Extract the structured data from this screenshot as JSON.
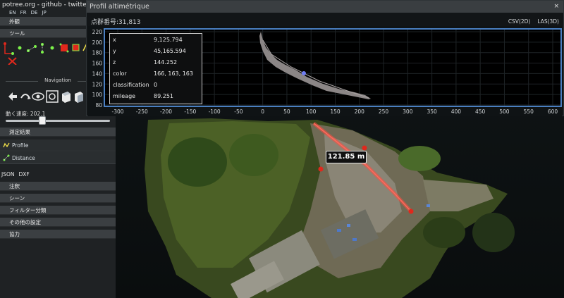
{
  "sidebar": {
    "brand": "potree.org - github - twitter",
    "languages": [
      "EN",
      "FR",
      "DE",
      "JP"
    ],
    "sections": {
      "appearance": "外観",
      "tools": "ツール",
      "navigation_title": "Navigation",
      "speed_label": "動く速度: 202.1",
      "measurements": "測定結果",
      "annotations": "注釈",
      "scene": "シーン",
      "filters": "フィルター分類",
      "other_settings": "その他の設定",
      "about": "協力"
    },
    "speed_slider": {
      "value": 0.35
    },
    "measurement_items": [
      {
        "label": "Profile",
        "icon": "profile-icon"
      },
      {
        "label": "Distance",
        "icon": "distance-icon"
      }
    ],
    "export": [
      "JSON",
      "DXF"
    ]
  },
  "profile_window": {
    "title": "Profil altimétrique",
    "close": "×",
    "point_count": "点群番号:31,813",
    "buttons": [
      "CSV(2D)",
      "LAS(3D)"
    ],
    "y_ticks": [
      "220",
      "200",
      "180",
      "160",
      "140",
      "120",
      "100",
      "80"
    ],
    "x_ticks": [
      "-300",
      "-250",
      "-200",
      "-150",
      "-100",
      "-50",
      "0",
      "50",
      "100",
      "150",
      "200",
      "250",
      "300",
      "350",
      "400",
      "450",
      "500",
      "550",
      "600"
    ],
    "info": [
      {
        "key": "x",
        "value": "9,125.794"
      },
      {
        "key": "y",
        "value": "45,165.594"
      },
      {
        "key": "z",
        "value": "144.252"
      },
      {
        "key": "color",
        "value": "166, 163, 163"
      },
      {
        "key": "classification",
        "value": "0"
      },
      {
        "key": "mileage",
        "value": "89.251"
      }
    ]
  },
  "scene": {
    "measurement_label": "121.85 m"
  },
  "colors": {
    "accent_border": "#4a7fc1",
    "measure_line": "#ff4d3f"
  }
}
